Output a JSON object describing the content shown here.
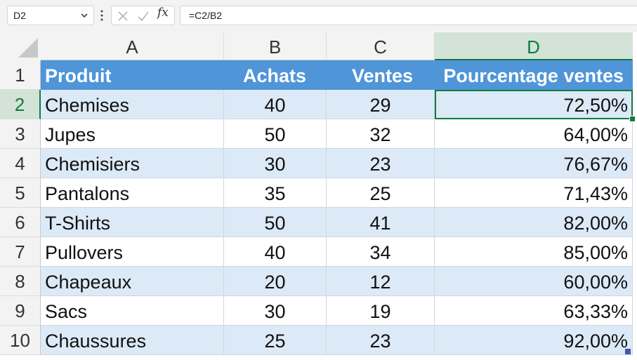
{
  "formula_bar": {
    "name_box": "D2",
    "fx_label": "fx",
    "formula": "=C2/B2"
  },
  "columns": [
    "A",
    "B",
    "C",
    "D"
  ],
  "selected_column": "D",
  "selected_row": "2",
  "rows": [
    "1",
    "2",
    "3",
    "4",
    "5",
    "6",
    "7",
    "8",
    "9",
    "10"
  ],
  "table": {
    "headers": [
      "Produit",
      "Achats",
      "Ventes",
      "Pourcentage ventes"
    ],
    "data": [
      [
        "Chemises",
        "40",
        "29",
        "72,50%"
      ],
      [
        "Jupes",
        "50",
        "32",
        "64,00%"
      ],
      [
        "Chemisiers",
        "30",
        "23",
        "76,67%"
      ],
      [
        "Pantalons",
        "35",
        "25",
        "71,43%"
      ],
      [
        "T-Shirts",
        "50",
        "41",
        "82,00%"
      ],
      [
        "Pullovers",
        "40",
        "34",
        "85,00%"
      ],
      [
        "Chapeaux",
        "20",
        "12",
        "60,00%"
      ],
      [
        "Sacs",
        "30",
        "19",
        "63,33%"
      ],
      [
        "Chaussures",
        "25",
        "23",
        "92,00%"
      ]
    ]
  },
  "colors": {
    "header_fill": "#4f95d8",
    "band_fill": "#dce9f6",
    "selection": "#107c41"
  }
}
